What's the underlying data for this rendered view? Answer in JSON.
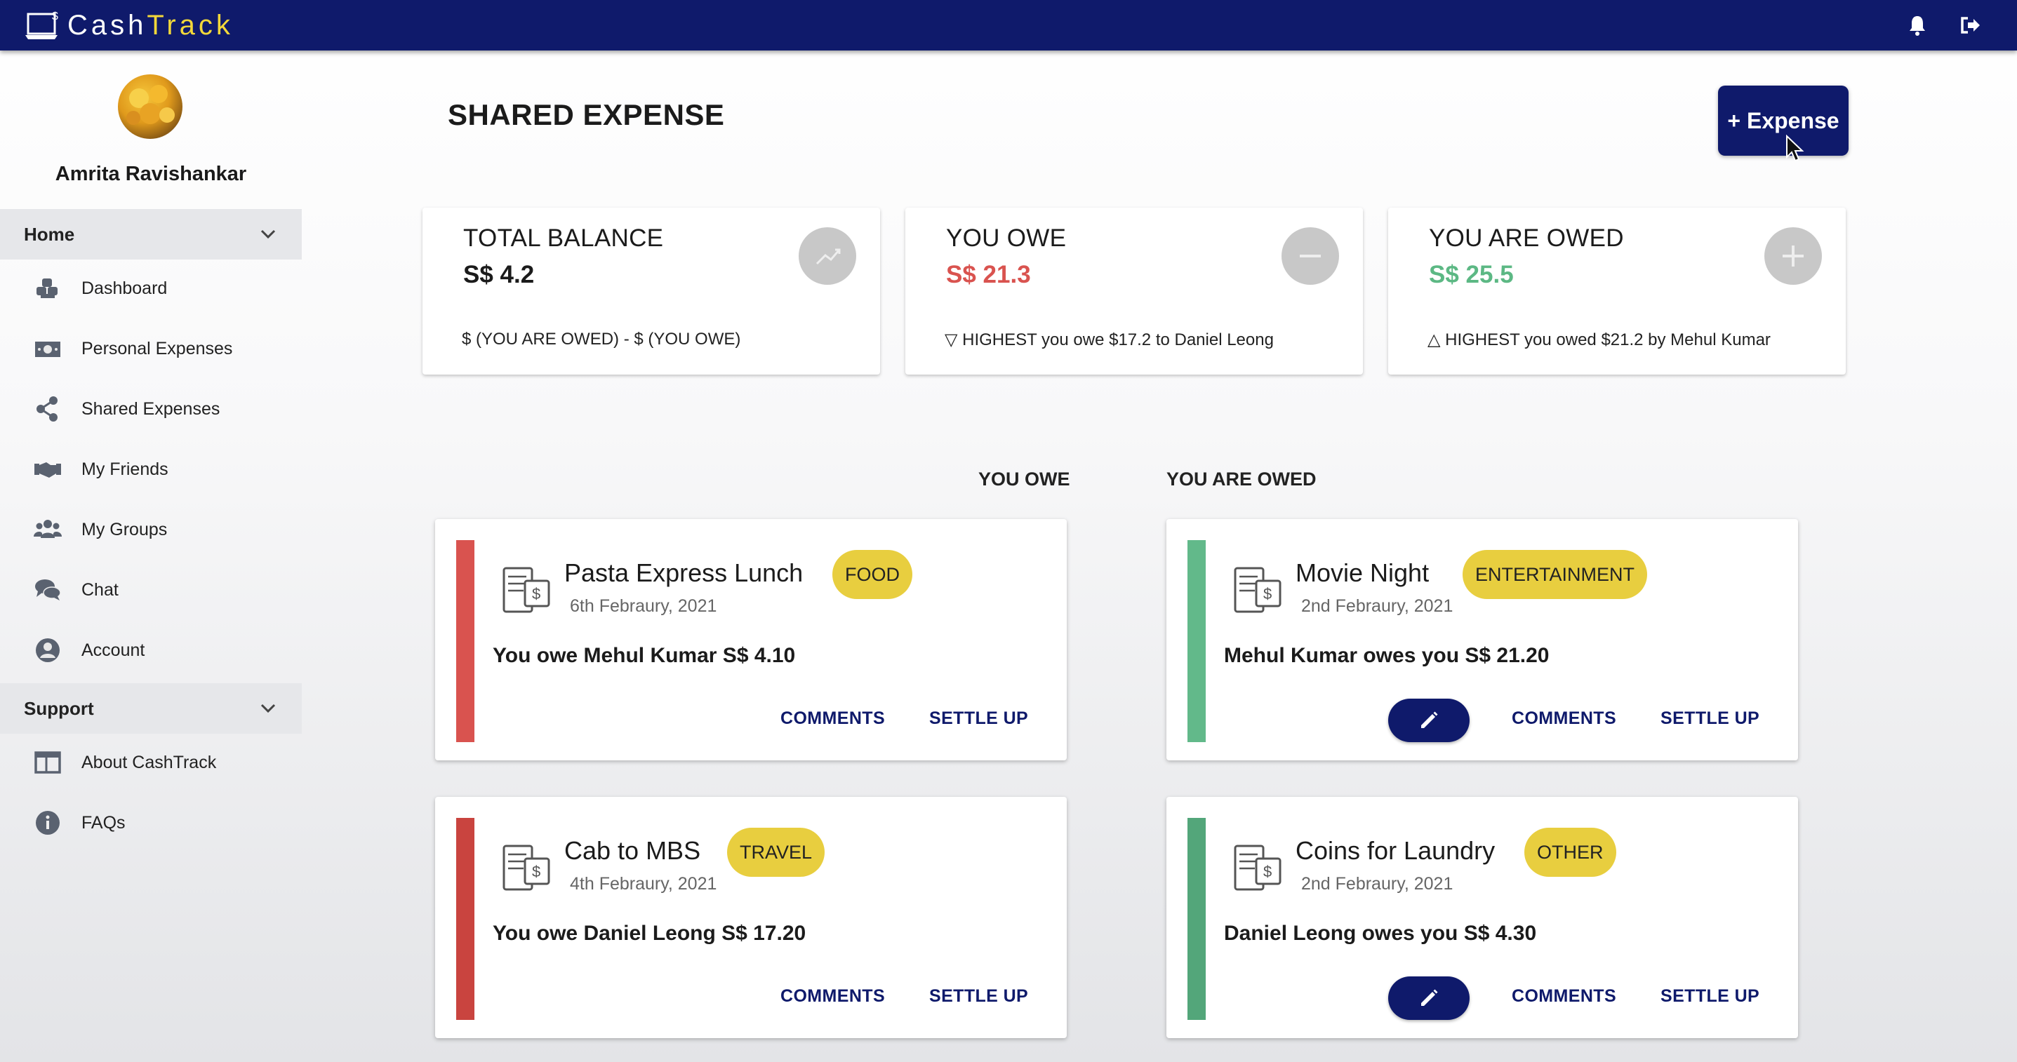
{
  "app": {
    "logo_cash": "Cash",
    "logo_track": "Track",
    "colors": {
      "primary": "#0f1a6b",
      "accent": "#f3d83a",
      "owe": "#d9534f",
      "owed": "#5cb884",
      "tag": "#e8ce3f"
    }
  },
  "user": {
    "name": "Amrita Ravishankar"
  },
  "sidebar": {
    "home_label": "Home",
    "support_label": "Support",
    "home_items": [
      {
        "label": "Dashboard",
        "icon": "dashboard-icon"
      },
      {
        "label": "Personal Expenses",
        "icon": "money-icon"
      },
      {
        "label": "Shared Expenses",
        "icon": "share-icon"
      },
      {
        "label": "My Friends",
        "icon": "handshake-icon"
      },
      {
        "label": "My Groups",
        "icon": "group-icon"
      },
      {
        "label": "Chat",
        "icon": "chat-icon"
      },
      {
        "label": "Account",
        "icon": "account-icon"
      }
    ],
    "support_items": [
      {
        "label": "About CashTrack",
        "icon": "info-panel-icon"
      },
      {
        "label": "FAQs",
        "icon": "info-icon"
      }
    ]
  },
  "main": {
    "title": "SHARED EXPENSE",
    "add_button": "+ Expense",
    "stats": [
      {
        "title": "TOTAL BALANCE",
        "value": "S$ 4.2",
        "note": "$ (YOU ARE OWED) - $ (YOU OWE)"
      },
      {
        "title": "YOU OWE",
        "value": "S$ 21.3",
        "note": "▽ HIGHEST you owe $17.2 to Daniel Leong"
      },
      {
        "title": "YOU ARE OWED",
        "value": "S$ 25.5",
        "note": "△ HIGHEST you owed $21.2 by Mehul Kumar"
      }
    ],
    "col_you_owe": "YOU OWE",
    "col_you_are_owed": "YOU ARE OWED",
    "comments_label": "COMMENTS",
    "settle_label": "SETTLE UP",
    "owe_expenses": [
      {
        "title": "Pasta Express Lunch",
        "date": "6th Febraury, 2021",
        "tag": "FOOD",
        "text": "You owe Mehul Kumar S$ 4.10"
      },
      {
        "title": "Cab to MBS",
        "date": "4th Febraury, 2021",
        "tag": "TRAVEL",
        "text": "You owe Daniel Leong S$ 17.20"
      }
    ],
    "owed_expenses": [
      {
        "title": "Movie Night",
        "date": "2nd Febraury, 2021",
        "tag": "ENTERTAINMENT",
        "text": "Mehul Kumar owes you S$ 21.20"
      },
      {
        "title": "Coins for Laundry",
        "date": "2nd Febraury, 2021",
        "tag": "OTHER",
        "text": "Daniel Leong owes you S$ 4.30"
      }
    ]
  }
}
